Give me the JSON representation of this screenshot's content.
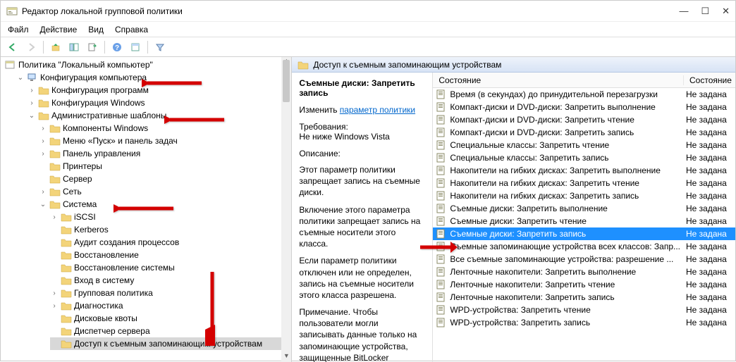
{
  "window": {
    "title": "Редактор локальной групповой политики"
  },
  "menu": {
    "file": "Файл",
    "action": "Действие",
    "view": "Вид",
    "help": "Справка"
  },
  "tree": {
    "root": "Политика \"Локальный компьютер\"",
    "computer_config": "Конфигурация компьютера",
    "software_settings": "Конфигурация программ",
    "windows_settings": "Конфигурация Windows",
    "admin_templates": "Административные шаблоны",
    "windows_components": "Компоненты Windows",
    "start_taskbar": "Меню «Пуск» и панель задач",
    "control_panel": "Панель управления",
    "printers": "Принтеры",
    "server": "Сервер",
    "network": "Сеть",
    "system": "Система",
    "iscsi": "iSCSI",
    "kerberos": "Kerberos",
    "audit": "Аудит создания процессов",
    "recovery": "Восстановление",
    "sys_restore": "Восстановление системы",
    "logon": "Вход в систему",
    "group_policy": "Групповая политика",
    "diagnostics": "Диагностика",
    "disk_quotas": "Дисковые квоты",
    "server_manager": "Диспетчер сервера",
    "removable_access": "Доступ к съемным запоминающим устройствам"
  },
  "right": {
    "header": "Доступ к съемным запоминающим устройствам",
    "cols": {
      "state": "Состояние",
      "state2": "Состояние"
    },
    "setting_name": "Съемные диски: Запретить запись",
    "edit_prefix": "Изменить ",
    "edit_link": "параметр политики",
    "req_label": "Требования:",
    "req_value": "Не ниже Windows Vista",
    "desc_label": "Описание:",
    "p1": "Этот параметр политики запрещает запись на съемные диски.",
    "p2": "Включение этого параметра политики запрещает запись на съемные носители этого класса.",
    "p3": "Если параметр политики отключен или не определен, запись на съемные носители этого класса разрешена.",
    "p4": "Примечание. Чтобы пользователи могли записывать данные только на запоминающие устройства, защищенные BitLocker",
    "items": [
      {
        "name": "Время (в секундах) до принудительной перезагрузки",
        "state": "Не задана"
      },
      {
        "name": "Компакт-диски и DVD-диски: Запретить выполнение",
        "state": "Не задана"
      },
      {
        "name": "Компакт-диски и DVD-диски: Запретить чтение",
        "state": "Не задана"
      },
      {
        "name": "Компакт-диски и DVD-диски: Запретить запись",
        "state": "Не задана"
      },
      {
        "name": "Специальные классы: Запретить чтение",
        "state": "Не задана"
      },
      {
        "name": "Специальные классы: Запретить запись",
        "state": "Не задана"
      },
      {
        "name": "Накопители на гибких дисках: Запретить выполнение",
        "state": "Не задана"
      },
      {
        "name": "Накопители на гибких дисках: Запретить чтение",
        "state": "Не задана"
      },
      {
        "name": "Накопители на гибких дисках: Запретить запись",
        "state": "Не задана"
      },
      {
        "name": "Съемные диски: Запретить выполнение",
        "state": "Не задана"
      },
      {
        "name": "Съемные диски: Запретить чтение",
        "state": "Не задана"
      },
      {
        "name": "Съемные диски: Запретить запись",
        "state": "Не задана",
        "selected": true
      },
      {
        "name": "Съемные запоминающие устройства всех классов: Запр...",
        "state": "Не задана"
      },
      {
        "name": "Все съемные запоминающие устройства: разрешение ...",
        "state": "Не задана"
      },
      {
        "name": "Ленточные накопители: Запретить выполнение",
        "state": "Не задана"
      },
      {
        "name": "Ленточные накопители: Запретить чтение",
        "state": "Не задана"
      },
      {
        "name": "Ленточные накопители: Запретить запись",
        "state": "Не задана"
      },
      {
        "name": "WPD-устройства: Запретить чтение",
        "state": "Не задана"
      },
      {
        "name": "WPD-устройства: Запретить запись",
        "state": "Не задана"
      }
    ]
  }
}
